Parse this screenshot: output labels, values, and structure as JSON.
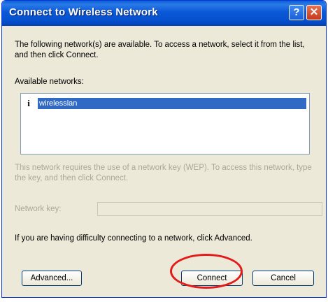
{
  "dialog": {
    "title": "Connect to Wireless Network",
    "help_glyph": "?",
    "close_glyph": "✕",
    "description": "The following network(s) are available. To access a network, select it from the list, and then click Connect.",
    "available_label": "Available networks:",
    "networks": [
      {
        "icon": "info-icon",
        "icon_glyph": "i",
        "name": "wirelesslan",
        "selected": true
      }
    ],
    "key_required_text": "This network requires the use of a network key (WEP). To access this network, type the key, and then click Connect.",
    "key_label": "Network key:",
    "key_value": "",
    "trouble_text": "If you are having difficulty connecting to a network, click Advanced.",
    "buttons": {
      "advanced": "Advanced...",
      "connect": "Connect",
      "cancel": "Cancel"
    }
  },
  "colors": {
    "titlebar": "#0a58d8",
    "selection": "#316ac5",
    "annotation": "#e41b1b",
    "disabled_text": "#aca899"
  }
}
